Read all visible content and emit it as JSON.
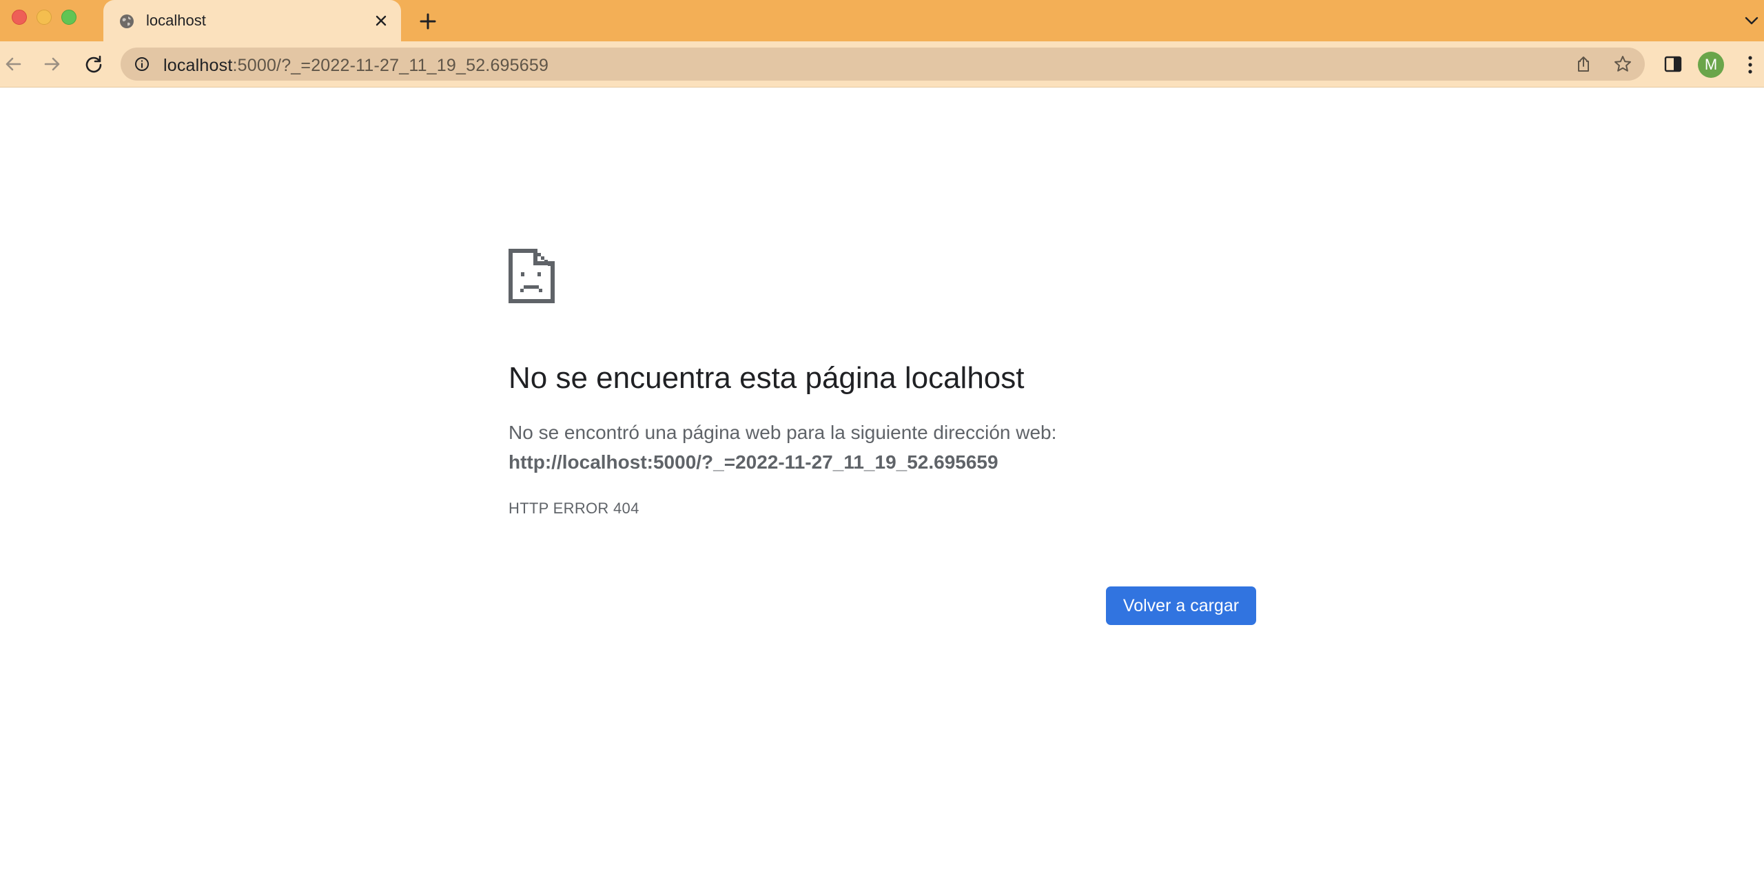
{
  "window": {
    "traffic_lights": [
      "close",
      "minimize",
      "zoom"
    ]
  },
  "tab": {
    "title": "localhost",
    "favicon": "globe-icon",
    "close_icon": "close-icon"
  },
  "toolbar": {
    "omnibox": {
      "url_host": "localhost",
      "url_rest": ":5000/?_=2022-11-27_11_19_52.695659"
    },
    "avatar_initial": "M"
  },
  "error_page": {
    "icon": "sad-document-icon",
    "title": "No se encuentra esta página localhost",
    "description": "No se encontró una página web para la siguiente dirección web:",
    "url": "http://localhost:5000/?_=2022-11-27_11_19_52.695659",
    "error_code": "HTTP ERROR 404",
    "reload_button_label": "Volver a cargar"
  },
  "colors": {
    "tabstrip_bg": "#f3af56",
    "toolbar_bg": "#fbe1bd",
    "omnibox_bg": "#e3c6a4",
    "button_blue": "#3174e0",
    "avatar_green": "#6aa54a"
  }
}
